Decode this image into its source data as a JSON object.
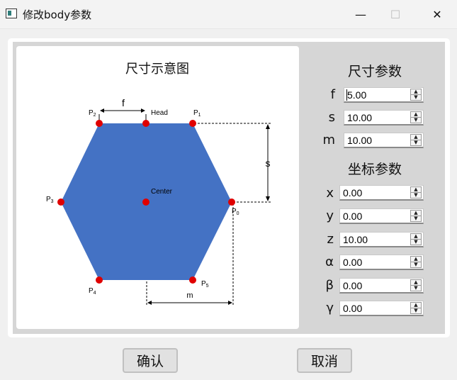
{
  "window": {
    "title": "修改body参数",
    "minimize_glyph": "—",
    "maximize_glyph": "☐",
    "close_glyph": "✕"
  },
  "diagram": {
    "title": "尺寸示意图",
    "fill_color": "#4472c4",
    "point_color": "#e00000",
    "labels": {
      "f": "f",
      "s": "s",
      "m": "m",
      "head": "Head",
      "center": "Center",
      "p0": "P",
      "p0_sub": "0",
      "p1": "P",
      "p1_sub": "1",
      "p2": "P",
      "p2_sub": "2",
      "p3": "P",
      "p3_sub": "3",
      "p4": "P",
      "p4_sub": "4",
      "p5": "P",
      "p5_sub": "5"
    }
  },
  "size_params": {
    "title": "尺寸参数",
    "fields": [
      {
        "label": "f",
        "value": "5.00"
      },
      {
        "label": "s",
        "value": "10.00"
      },
      {
        "label": "m",
        "value": "10.00"
      }
    ]
  },
  "coord_params": {
    "title": "坐标参数",
    "fields": [
      {
        "label": "x",
        "value": "0.00"
      },
      {
        "label": "y",
        "value": "0.00"
      },
      {
        "label": "z",
        "value": "10.00"
      },
      {
        "label": "α",
        "value": "0.00"
      },
      {
        "label": "β",
        "value": "0.00"
      },
      {
        "label": "γ",
        "value": "0.00"
      }
    ]
  },
  "spin_arrows": {
    "up": "▲",
    "down": "▼"
  },
  "buttons": {
    "ok": "确认",
    "cancel": "取消"
  }
}
